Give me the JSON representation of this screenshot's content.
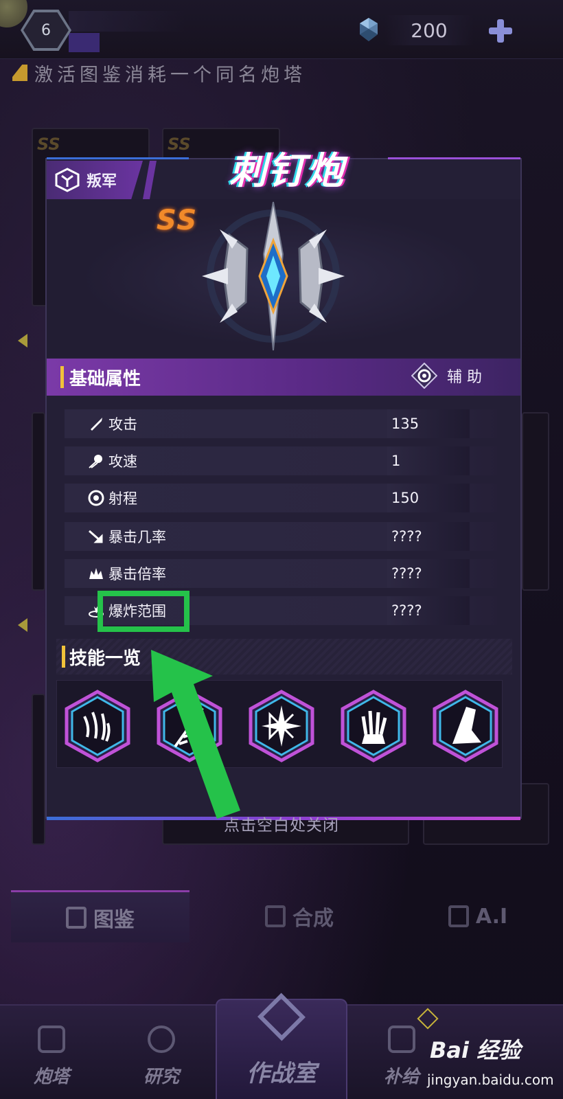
{
  "topbar": {
    "level": "6",
    "currency_amount": "200",
    "icons": [
      "gem-icon",
      "plus-icon"
    ]
  },
  "hint": {
    "text": "激活图鉴消耗一个同名炮塔"
  },
  "modal": {
    "faction": "叛军",
    "tower_name": "刺钉炮",
    "rank": "SS",
    "basic_section": {
      "title": "基础属性",
      "role": "辅 助"
    },
    "stats": [
      {
        "label": "攻击",
        "value": "135",
        "icon": "attack-icon"
      },
      {
        "label": "攻速",
        "value": "1",
        "icon": "attack-speed-icon"
      },
      {
        "label": "射程",
        "value": "150",
        "icon": "range-icon"
      },
      {
        "label": "暴击几率",
        "value": "????",
        "icon": "crit-chance-icon"
      },
      {
        "label": "暴击倍率",
        "value": "????",
        "icon": "crit-multiplier-icon"
      },
      {
        "label": "爆炸范围",
        "value": "????",
        "icon": "explosion-range-icon"
      }
    ],
    "skills_section": {
      "title": "技能一览"
    },
    "skills": [
      "claw-skill-icon",
      "spike-skill-icon",
      "star-burst-skill-icon",
      "hand-skill-icon",
      "leg-skill-icon"
    ]
  },
  "close_hint": "点击空白处关闭",
  "tabs": [
    {
      "label": "图鉴",
      "active": true
    },
    {
      "label": "合成",
      "active": false
    },
    {
      "label": "A.I",
      "active": false
    }
  ],
  "bottom_nav": [
    {
      "label": "炮塔"
    },
    {
      "label": "研究"
    },
    {
      "label": "作战室"
    },
    {
      "label": "补给"
    }
  ],
  "watermark": {
    "main": "Bai 经验",
    "sub": "jingyan.baidu.com"
  },
  "colors": {
    "accent_purple": "#7b3aa8",
    "highlight_green": "#25c24a",
    "rank_orange": "#f18a2a",
    "title_bar_yellow": "#f0c23a"
  }
}
